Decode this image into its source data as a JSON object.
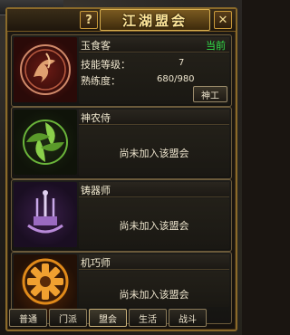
{
  "window": {
    "title": "江湖盟会",
    "help_label": "?",
    "close_label": "✕"
  },
  "professions": [
    {
      "name": "玉食客",
      "status": "当前",
      "stats": {
        "level_label": "技能等级：",
        "level_value": "7",
        "proficiency_label": "熟练度：",
        "proficiency_value": "680/980"
      },
      "action_label": "神工",
      "emblem": "chef-emblem-icon",
      "color": "#8a1c14"
    },
    {
      "name": "神农侍",
      "message": "尚未加入该盟会",
      "emblem": "herbalist-emblem-icon",
      "color": "#6ab43a"
    },
    {
      "name": "铸器师",
      "message": "尚未加入该盟会",
      "emblem": "smith-emblem-icon",
      "color": "#8a5ab0"
    },
    {
      "name": "机巧师",
      "message": "尚未加入该盟会",
      "emblem": "mechanist-emblem-icon",
      "color": "#e08a1a"
    }
  ],
  "tabs": [
    {
      "label": "普通"
    },
    {
      "label": "门派"
    },
    {
      "label": "盟会",
      "active": true
    },
    {
      "label": "生活"
    },
    {
      "label": "战斗"
    }
  ],
  "colors": {
    "frame_gold": "#c99a3a",
    "status_green": "#33e04a"
  }
}
